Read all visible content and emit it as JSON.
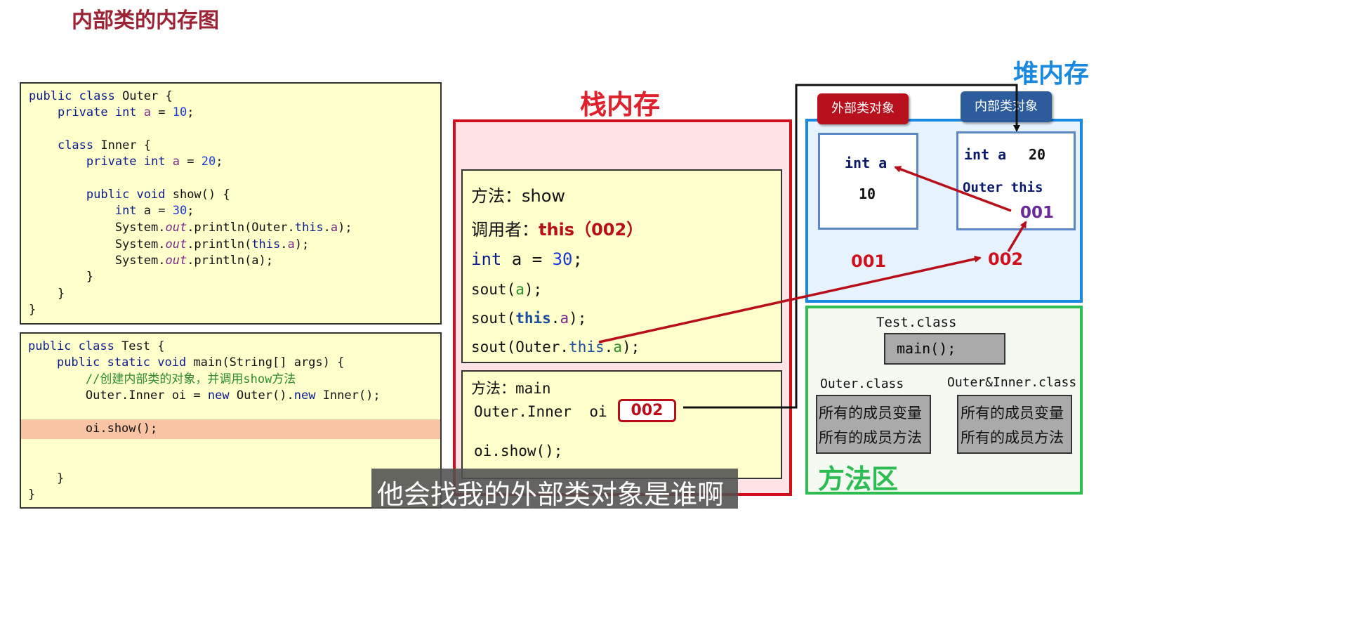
{
  "title": "内部类的内存图",
  "code_outer": [
    "public class Outer {",
    "    private int a = 10;",
    "",
    "    class Inner {",
    "        private int a = 20;",
    "",
    "        public void show() {",
    "            int a = 30;",
    "            System.out.println(Outer.this.a);",
    "            System.out.println(this.a);",
    "            System.out.println(a);",
    "        }",
    "    }",
    "}"
  ],
  "code_test": [
    "public class Test {",
    "    public static void main(String[] args) {",
    "        //创建内部类的对象，并调用show方法",
    "        Outer.Inner oi = new Outer().new Inner();",
    "",
    "        oi.show();",
    "",
    "",
    "    }",
    "}"
  ],
  "stack": {
    "title": "栈内存",
    "show_frame": {
      "method": "方法：show",
      "caller_label": "调用者：",
      "caller_value": "this（002）",
      "line_int": "int a = 30;",
      "line1": "sout(a);",
      "line2": "sout(this.a);",
      "line3": "sout(Outer.this.a);"
    },
    "main_frame": {
      "method": "方法：main",
      "var_decl": "Outer.Inner  oi",
      "var_value": "002",
      "call": "oi.show();"
    }
  },
  "heap": {
    "title": "堆内存",
    "outer_tag": "外部类对象",
    "inner_tag": "内部类对象",
    "outer_obj": {
      "field": "int a",
      "value": "10",
      "address": "001"
    },
    "inner_obj": {
      "field": "int a",
      "value": "20",
      "outer_ref_label": "Outer this",
      "outer_ref_value": "001",
      "address": "002"
    }
  },
  "method_area": {
    "title": "方法区",
    "test_class": "Test.class",
    "main": "main();",
    "outer_class": "Outer.class",
    "inner_class": "Outer&Inner.class",
    "members_vars": "所有的成员变量",
    "members_methods": "所有的成员方法"
  },
  "subtitle": "他会找我的外部类对象是谁啊",
  "colors": {
    "red": "#d0101c",
    "blue": "#1a8ae0",
    "green": "#2dbd52",
    "title": "#9b2335"
  }
}
